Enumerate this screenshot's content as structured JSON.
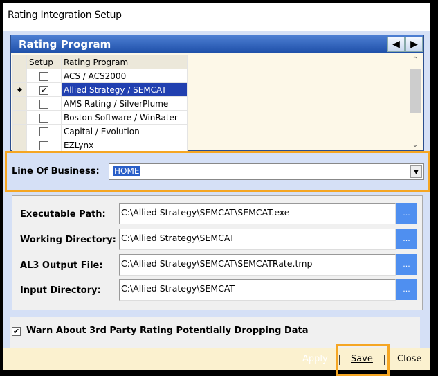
{
  "window": {
    "title": "Rating Integration Setup"
  },
  "rating_program": {
    "header": "Rating Program",
    "columns": [
      "Setup",
      "Rating Program"
    ],
    "rows": [
      {
        "setup": false,
        "name": "ACS / ACS2000",
        "current": false,
        "selected": false
      },
      {
        "setup": true,
        "name": "Allied Strategy / SEMCAT",
        "current": true,
        "selected": true
      },
      {
        "setup": false,
        "name": "AMS Rating / SilverPlume",
        "current": false,
        "selected": false
      },
      {
        "setup": false,
        "name": "Boston Software / WinRater",
        "current": false,
        "selected": false
      },
      {
        "setup": false,
        "name": "Capital / Evolution",
        "current": false,
        "selected": false
      },
      {
        "setup": false,
        "name": "EZLynx",
        "current": false,
        "selected": false
      }
    ]
  },
  "line_of_business": {
    "label": "Line Of Business:",
    "value": "HOME"
  },
  "fields": [
    {
      "label": "Executable Path:",
      "value": "C:\\Allied Strategy\\SEMCAT\\SEMCAT.exe",
      "button": "..."
    },
    {
      "label": "Working Directory:",
      "value": "C:\\Allied Strategy\\SEMCAT",
      "button": "..."
    },
    {
      "label": "AL3 Output File:",
      "value": "C:\\Allied Strategy\\SEMCAT\\SEMCATRate.tmp",
      "button": "..."
    },
    {
      "label": "Input Directory:",
      "value": "C:\\Allied Strategy\\SEMCAT",
      "button": "..."
    }
  ],
  "warn": {
    "label": "Warn About 3rd Party Rating Potentially Dropping Data",
    "checked": true
  },
  "buttons": {
    "apply": "Apply",
    "save": "Save",
    "close": "Close"
  },
  "colors": {
    "highlight": "#f5a623",
    "header": "#1e4fa8",
    "selection": "#2140b0"
  }
}
